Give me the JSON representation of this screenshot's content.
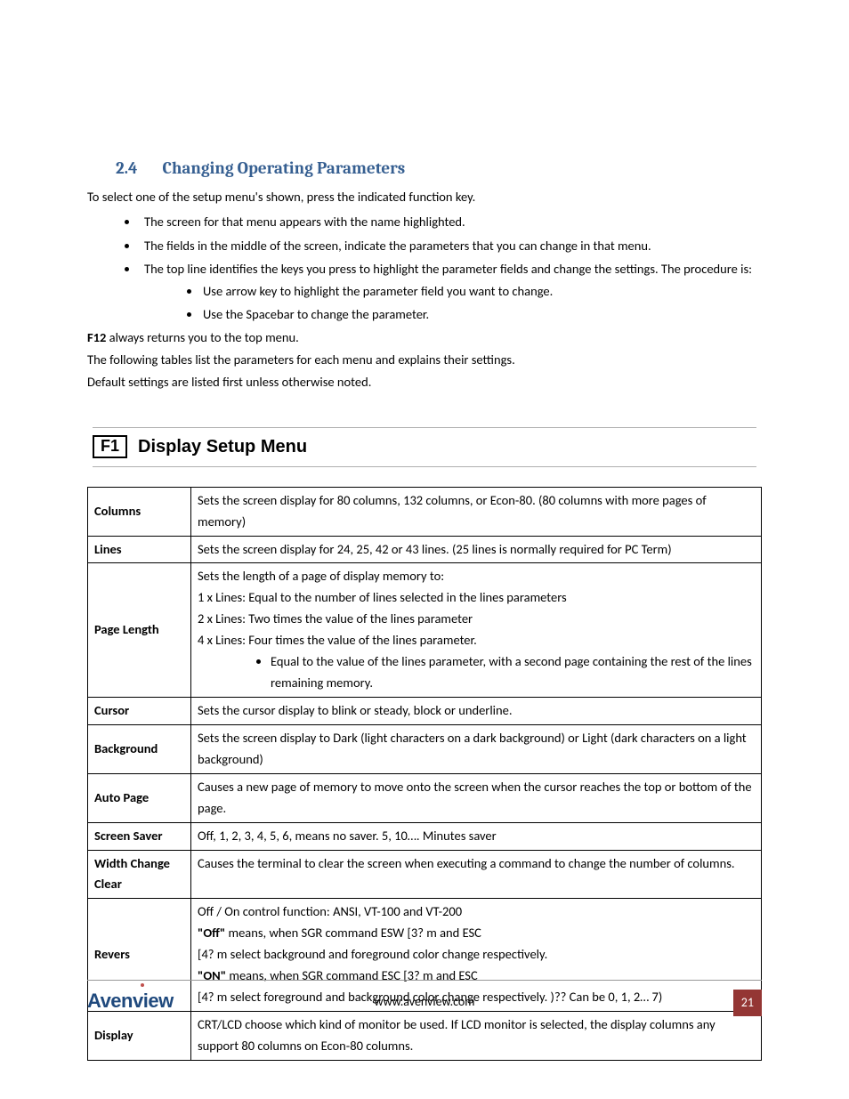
{
  "heading": {
    "number": "2.4",
    "title": "Changing Operating Parameters"
  },
  "intro": "To select one of the setup menu's shown, press the indicated function key.",
  "bullets": {
    "b1": "The screen for that menu appears with the name highlighted.",
    "b2": "The fields in the middle of the screen, indicate the parameters that you can change in that menu.",
    "b3": "The top line identifies the keys you press to highlight the parameter fields and change the settings. The procedure is:",
    "b3a": "Use arrow key to highlight the parameter field you want to change.",
    "b3b": "Use the Spacebar to change the parameter."
  },
  "after": {
    "p1_bold": "F12",
    "p1_rest": " always returns you to the top menu.",
    "p2": "The following tables list the parameters for each menu and explains their settings.",
    "p3": "Default settings are listed first unless otherwise noted."
  },
  "menu": {
    "key": "F1",
    "title": "Display Setup Menu"
  },
  "rows": {
    "columns": {
      "label": "Columns",
      "desc": "Sets the screen display for 80 columns, 132 columns, or Econ-80. (80 columns with more pages of memory)"
    },
    "lines": {
      "label": "Lines",
      "desc": "Sets the screen display for 24, 25, 42 or 43 lines. (25 lines is normally required for PC Term)"
    },
    "pageLength": {
      "label": "Page Length",
      "l1": "Sets the length of a page of display memory to:",
      "l2": "1 x Lines: Equal to the number of lines selected in the lines parameters",
      "l3": "2 x Lines: Two times the value of the lines parameter",
      "l4": "4 x Lines: Four times the value of the lines parameter.",
      "bullet": "Equal to the value of the lines parameter, with a second page containing the rest of the lines remaining memory."
    },
    "cursor": {
      "label": "Cursor",
      "desc": "Sets the cursor display to blink or steady, block or underline."
    },
    "background": {
      "label": "Background",
      "desc": "Sets the screen display to Dark (light characters on a dark background) or Light (dark characters on a light background)"
    },
    "autoPage": {
      "label": "Auto Page",
      "desc": "Causes a new page of memory to move onto the screen when the cursor reaches the top or bottom of the page."
    },
    "screenSaver": {
      "label": "Screen Saver",
      "desc": "Off, 1, 2, 3, 4, 5, 6, means no saver. 5, 10…. Minutes saver"
    },
    "widthChange": {
      "label": "Width Change Clear",
      "desc": "Causes the terminal to clear the screen when executing a command to change the number of columns."
    },
    "revers": {
      "label": "Revers",
      "l1": "Off / On control function: ANSI, VT-100 and VT-200",
      "l2a": "\"Off\"",
      "l2b": " means, when SGR command ESW [3? m and ESC",
      "l3": "[4? m select background and foreground color change respectively.",
      "l4a": "\"ON\"",
      "l4b": " means, when SGR command ESC [3? m and ESC",
      "l5": "[4? m select foreground and background color change respectively. )?? Can be 0, 1, 2… 7)"
    },
    "display": {
      "label": "Display",
      "desc": "CRT/LCD choose which kind of monitor be used. If LCD monitor is selected, the display columns any support 80 columns on Econ-80 columns."
    }
  },
  "footer": {
    "brand": "Avenview",
    "url": "www.avenview.com",
    "page": "21"
  }
}
